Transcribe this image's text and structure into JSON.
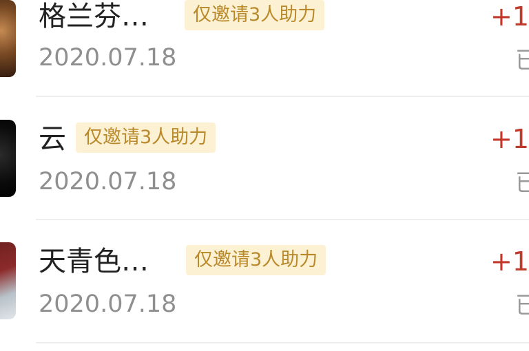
{
  "records": [
    {
      "name": "格兰芬…",
      "badge": "仅邀请3人助力",
      "date": "2020.07.18",
      "reward": "+1",
      "status": "已"
    },
    {
      "name": "云",
      "badge": "仅邀请3人助力",
      "date": "2020.07.18",
      "reward": "+1",
      "status": "已"
    },
    {
      "name": "天青色…",
      "badge": "仅邀请3人助力",
      "date": "2020.07.18",
      "reward": "+1",
      "status": "已"
    }
  ],
  "colors": {
    "badge_background": "#fdf1d3",
    "badge_text": "#b98a2c",
    "reward_text": "#c0392b",
    "date_text": "#8f8f8f"
  }
}
